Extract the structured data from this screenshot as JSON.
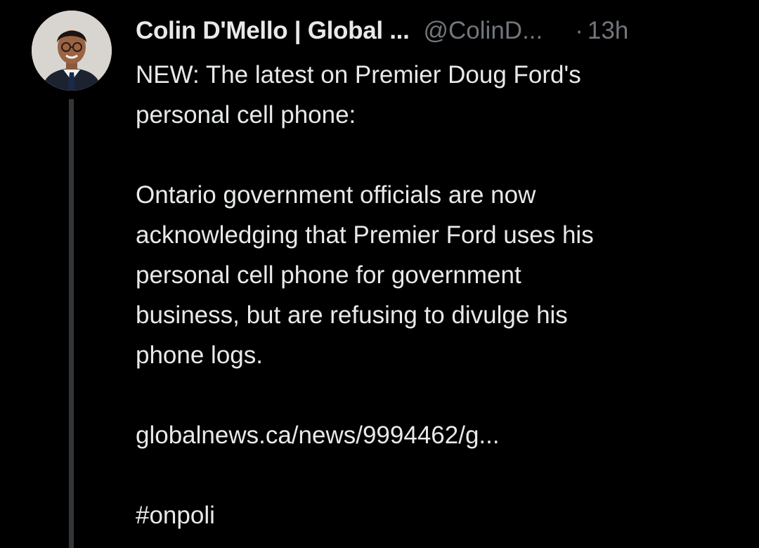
{
  "tweet": {
    "author": {
      "display_name": "Colin D'Mello | Global ...",
      "handle": "@ColinD...",
      "separator": "·",
      "timestamp": "13h",
      "avatar_icon": "user-avatar-photo"
    },
    "text": {
      "line1": "NEW: The latest on Premier Doug Ford's",
      "line2": "personal cell phone:",
      "para2_line1": "Ontario government officials are now",
      "para2_line2": "acknowledging that Premier Ford uses his",
      "para2_line3": "personal cell phone for government",
      "para2_line4": "business, but are refusing to divulge his",
      "para2_line5": "phone logs.",
      "link": "globalnews.ca/news/9994462/g...",
      "hashtag": "#onpoli"
    },
    "colors": {
      "background": "#000000",
      "primary_text": "#e7e9ea",
      "secondary_text": "#71767b",
      "thread_line": "#333639"
    }
  }
}
